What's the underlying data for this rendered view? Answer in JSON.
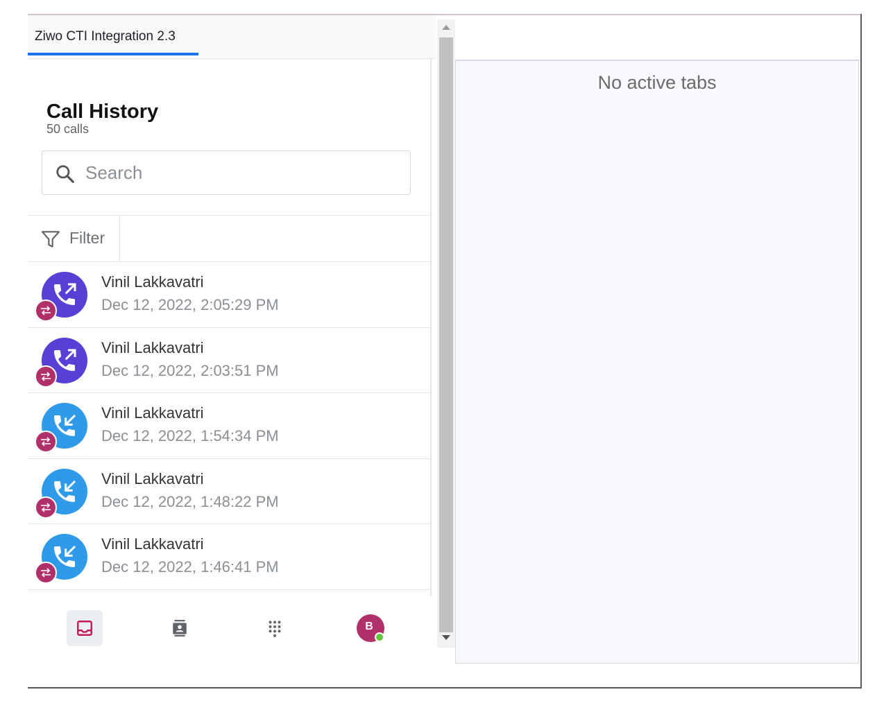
{
  "tab": {
    "label": "Ziwo CTI Integration 2.3"
  },
  "history": {
    "title": "Call History",
    "count": "50 calls"
  },
  "search": {
    "placeholder": "Search",
    "value": ""
  },
  "filter": {
    "label": "Filter"
  },
  "calls": [
    {
      "name": "Vinil Lakkavatri",
      "time": "Dec 12, 2022, 2:05:29 PM",
      "direction": "outbound"
    },
    {
      "name": "Vinil Lakkavatri",
      "time": "Dec 12, 2022, 2:03:51 PM",
      "direction": "outbound"
    },
    {
      "name": "Vinil Lakkavatri",
      "time": "Dec 12, 2022, 1:54:34 PM",
      "direction": "inbound"
    },
    {
      "name": "Vinil Lakkavatri",
      "time": "Dec 12, 2022, 1:48:22 PM",
      "direction": "inbound"
    },
    {
      "name": "Vinil Lakkavatri",
      "time": "Dec 12, 2022, 1:46:41 PM",
      "direction": "inbound"
    }
  ],
  "nav": {
    "items": [
      "inbox-icon",
      "contacts-icon",
      "dialpad-icon"
    ],
    "user_initial": "B",
    "presence": "online"
  },
  "right_panel": {
    "empty_message": "No active tabs"
  },
  "colors": {
    "accent": "#1a73e8",
    "outbound": "#5a3fd6",
    "inbound": "#2f9be8",
    "badge": "#b0306a",
    "presence_online": "#66c440"
  }
}
